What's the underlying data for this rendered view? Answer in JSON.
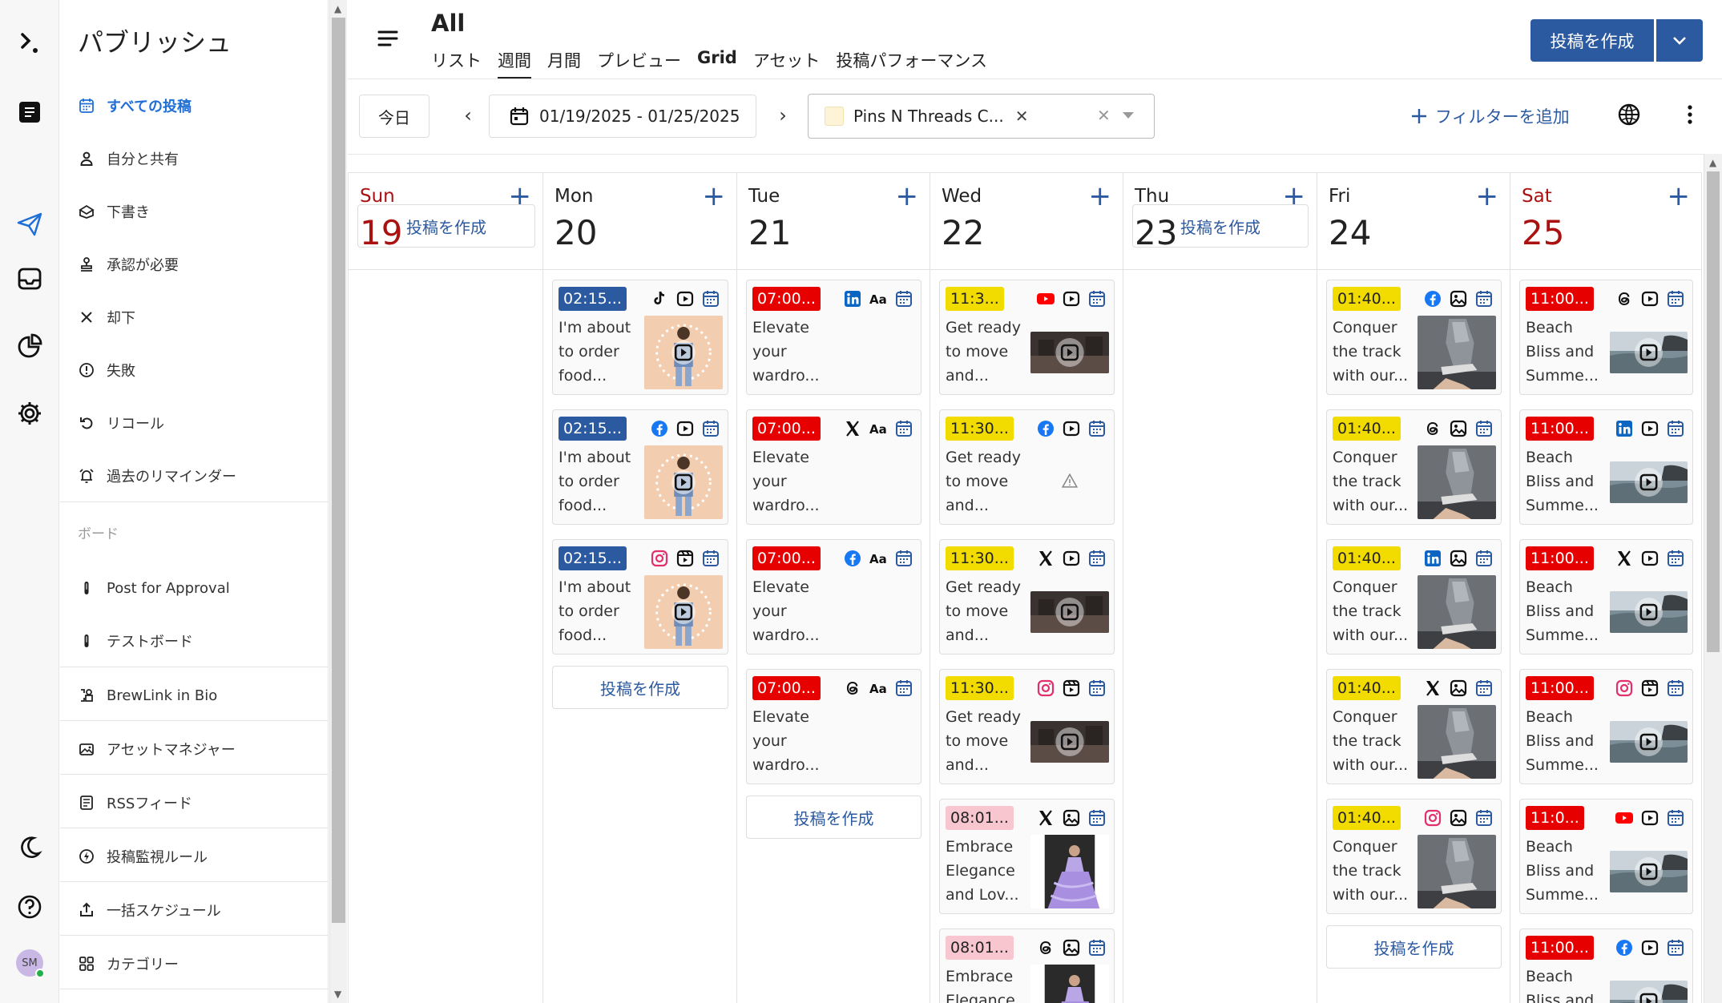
{
  "rail": {
    "items": [
      {
        "name": "logo-icon"
      },
      {
        "name": "compose-icon"
      },
      {
        "name": "publish-icon"
      },
      {
        "name": "inbox-icon"
      },
      {
        "name": "analytics-icon"
      },
      {
        "name": "settings-icon"
      },
      {
        "name": "dark-mode-icon"
      },
      {
        "name": "help-icon"
      }
    ],
    "avatar_initials": "SM"
  },
  "sidebar": {
    "title": "パブリッシュ",
    "items": [
      {
        "label": "すべての投稿",
        "icon": "calendar-icon",
        "active": true
      },
      {
        "label": "自分と共有",
        "icon": "user-icon"
      },
      {
        "label": "下書き",
        "icon": "draft-icon"
      },
      {
        "label": "承認が必要",
        "icon": "stamp-icon"
      },
      {
        "label": "却下",
        "icon": "close-icon"
      },
      {
        "label": "失敗",
        "icon": "alert-circle-icon"
      },
      {
        "label": "リコール",
        "icon": "undo-icon"
      },
      {
        "label": "過去のリマインダー",
        "icon": "alarm-icon"
      }
    ],
    "boards_label": "ボード",
    "boards": [
      {
        "label": "Post for Approval",
        "icon": "pin-icon"
      },
      {
        "label": "テストボード",
        "icon": "pin-icon"
      }
    ],
    "tools": [
      {
        "label": "BrewLink in Bio",
        "icon": "link-icon"
      },
      {
        "label": "アセットマネジャー",
        "icon": "image-folder-icon"
      },
      {
        "label": "RSSフィード",
        "icon": "rss-icon"
      },
      {
        "label": "投稿監視ルール",
        "icon": "bolt-icon"
      },
      {
        "label": "一括スケジュール",
        "icon": "upload-icon"
      },
      {
        "label": "カテゴリー",
        "icon": "grid-icon"
      }
    ]
  },
  "header": {
    "title": "All",
    "tabs": [
      {
        "label": "リスト"
      },
      {
        "label": "週間",
        "active": true
      },
      {
        "label": "月間"
      },
      {
        "label": "プレビュー"
      },
      {
        "label": "Grid",
        "bold": true
      },
      {
        "label": "アセット"
      },
      {
        "label": "投稿パフォーマンス"
      }
    ],
    "create_label": "投稿を作成"
  },
  "toolbar": {
    "today_label": "今日",
    "date_range": "01/19/2025 - 01/25/2025",
    "account_chip": "Pins N Threads C...",
    "add_filter_label": "フィルターを追加"
  },
  "calendar": {
    "create_label": "投稿を作成",
    "days": [
      {
        "name": "Sun",
        "num": "19",
        "weekend": true,
        "posts": []
      },
      {
        "name": "Mon",
        "num": "20",
        "posts": [
          {
            "time": "02:15...",
            "tc": "t-blue",
            "icons": [
              "tiktok-icon",
              "video-icon",
              "calendar-icon"
            ],
            "text": "I'm about\nto order\nfood...",
            "thumb": "woman-video"
          },
          {
            "time": "02:15...",
            "tc": "t-blue",
            "icons": [
              "facebook-icon",
              "video-icon",
              "calendar-icon"
            ],
            "text": "I'm about\nto order\nfood...",
            "thumb": "woman-video"
          },
          {
            "time": "02:15...",
            "tc": "t-blue",
            "icons": [
              "instagram-icon",
              "reel-icon",
              "calendar-icon"
            ],
            "text": "I'm about\nto order\nfood...",
            "thumb": "woman-video"
          }
        ]
      },
      {
        "name": "Tue",
        "num": "21",
        "posts": [
          {
            "time": "07:00...",
            "tc": "t-red",
            "icons": [
              "linkedin-icon",
              "text-icon",
              "calendar-icon"
            ],
            "text": "Elevate\nyour\nwardro..."
          },
          {
            "time": "07:00...",
            "tc": "t-red",
            "icons": [
              "x-icon",
              "text-icon",
              "calendar-icon"
            ],
            "text": "Elevate\nyour\nwardro..."
          },
          {
            "time": "07:00...",
            "tc": "t-red",
            "icons": [
              "facebook-icon",
              "text-icon",
              "calendar-icon"
            ],
            "text": "Elevate\nyour\nwardro..."
          },
          {
            "time": "07:00...",
            "tc": "t-red",
            "icons": [
              "threads-icon",
              "text-icon",
              "calendar-icon"
            ],
            "text": "Elevate\nyour\nwardro..."
          }
        ]
      },
      {
        "name": "Wed",
        "num": "22",
        "posts": [
          {
            "time": "11:3...",
            "tc": "t-yellow",
            "icons": [
              "youtube-icon",
              "video-icon",
              "calendar-icon"
            ],
            "text": "Get ready\nto move\nand...",
            "thumb": "dark-video"
          },
          {
            "time": "11:30...",
            "tc": "t-yellow",
            "icons": [
              "facebook-icon",
              "video-icon",
              "calendar-icon"
            ],
            "text": "Get ready\nto move\nand...",
            "thumb": "warning"
          },
          {
            "time": "11:30...",
            "tc": "t-yellow",
            "icons": [
              "x-icon",
              "video-icon",
              "calendar-icon"
            ],
            "text": "Get ready\nto move\nand...",
            "thumb": "dark-video"
          },
          {
            "time": "11:30...",
            "tc": "t-yellow",
            "icons": [
              "instagram-icon",
              "reel-icon",
              "calendar-icon"
            ],
            "text": "Get ready\nto move\nand...",
            "thumb": "dark-video"
          },
          {
            "time": "08:01...",
            "tc": "t-pink",
            "icons": [
              "x-icon",
              "image-icon",
              "calendar-icon"
            ],
            "text": "Embrace\nElegance\nand Lov...",
            "thumb": "dress"
          },
          {
            "time": "08:01...",
            "tc": "t-pink",
            "icons": [
              "threads-icon",
              "image-icon",
              "calendar-icon"
            ],
            "text": "Embrace\nElegance\nand Lov...",
            "thumb": "dress"
          }
        ]
      },
      {
        "name": "Thu",
        "num": "23",
        "posts": []
      },
      {
        "name": "Fri",
        "num": "24",
        "posts": [
          {
            "time": "01:40...",
            "tc": "t-yellow",
            "icons": [
              "facebook-icon",
              "image-icon",
              "calendar-icon"
            ],
            "text": "Conquer\nthe track\nwith our...",
            "thumb": "shoe"
          },
          {
            "time": "01:40...",
            "tc": "t-yellow",
            "icons": [
              "threads-icon",
              "image-icon",
              "calendar-icon"
            ],
            "text": "Conquer\nthe track\nwith our...",
            "thumb": "shoe"
          },
          {
            "time": "01:40...",
            "tc": "t-yellow",
            "icons": [
              "linkedin-icon",
              "image-icon",
              "calendar-icon"
            ],
            "text": "Conquer\nthe track\nwith our...",
            "thumb": "shoe"
          },
          {
            "time": "01:40...",
            "tc": "t-yellow",
            "icons": [
              "x-icon",
              "image-icon",
              "calendar-icon"
            ],
            "text": "Conquer\nthe track\nwith our...",
            "thumb": "shoe"
          },
          {
            "time": "01:40...",
            "tc": "t-yellow",
            "icons": [
              "instagram-icon",
              "image-icon",
              "calendar-icon"
            ],
            "text": "Conquer\nthe track\nwith our...",
            "thumb": "shoe"
          }
        ]
      },
      {
        "name": "Sat",
        "num": "25",
        "weekend": true,
        "posts": [
          {
            "time": "11:00...",
            "tc": "t-red",
            "icons": [
              "threads-icon",
              "video-icon",
              "calendar-icon"
            ],
            "text": "Beach\nBliss and\nSumme...",
            "thumb": "beach"
          },
          {
            "time": "11:00...",
            "tc": "t-red",
            "icons": [
              "linkedin-icon",
              "video-icon",
              "calendar-icon"
            ],
            "text": "Beach\nBliss and\nSumme...",
            "thumb": "beach"
          },
          {
            "time": "11:00...",
            "tc": "t-red",
            "icons": [
              "x-icon",
              "video-icon",
              "calendar-icon"
            ],
            "text": "Beach\nBliss and\nSumme...",
            "thumb": "beach"
          },
          {
            "time": "11:00...",
            "tc": "t-red",
            "icons": [
              "instagram-icon",
              "reel-icon",
              "calendar-icon"
            ],
            "text": "Beach\nBliss and\nSumme...",
            "thumb": "beach"
          },
          {
            "time": "11:0...",
            "tc": "t-red",
            "icons": [
              "youtube-icon",
              "video-icon",
              "calendar-icon"
            ],
            "text": "Beach\nBliss and\nSumme...",
            "thumb": "beach"
          },
          {
            "time": "11:00...",
            "tc": "t-red",
            "icons": [
              "facebook-icon",
              "video-icon",
              "calendar-icon"
            ],
            "text": "Beach\nBliss and\nSumme...",
            "thumb": "beach"
          }
        ]
      }
    ]
  },
  "colors": {
    "primary": "#2c5aa0",
    "active_link": "#1f6fd6",
    "weekend": "#aa1111"
  }
}
